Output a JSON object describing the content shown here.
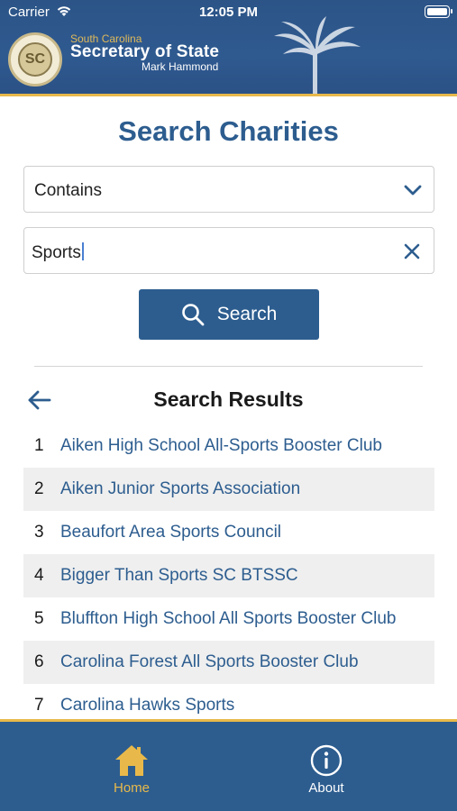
{
  "status_bar": {
    "carrier": "Carrier",
    "time": "12:05 PM"
  },
  "header": {
    "agency_state": "South Carolina",
    "agency_title": "Secretary of State",
    "official_name": "Mark Hammond"
  },
  "page": {
    "title": "Search Charities"
  },
  "search": {
    "match_type": "Contains",
    "query": "Sports",
    "button_label": "Search"
  },
  "results": {
    "title": "Search Results",
    "items": [
      {
        "num": "1",
        "name": "Aiken High School All-Sports Booster Club"
      },
      {
        "num": "2",
        "name": "Aiken Junior Sports Association"
      },
      {
        "num": "3",
        "name": "Beaufort Area Sports Council"
      },
      {
        "num": "4",
        "name": "Bigger Than Sports SC BTSSC"
      },
      {
        "num": "5",
        "name": "Bluffton High School All Sports Booster Club"
      },
      {
        "num": "6",
        "name": "Carolina Forest All Sports Booster Club"
      },
      {
        "num": "7",
        "name": "Carolina Hawks Sports"
      }
    ]
  },
  "tabs": [
    {
      "label": "Home",
      "icon": "home-icon",
      "active": true
    },
    {
      "label": "About",
      "icon": "info-icon",
      "active": false
    }
  ],
  "colors": {
    "primary": "#2d5d8f",
    "accent": "#e8b94a"
  }
}
